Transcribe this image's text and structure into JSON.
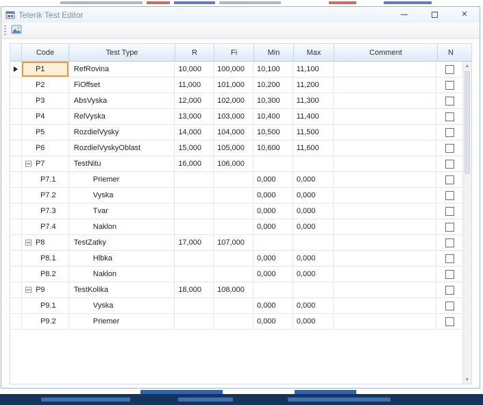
{
  "window": {
    "title": "Telerik Test Editor"
  },
  "toolbar": {
    "image_tool": "image-icon"
  },
  "grid": {
    "columns": [
      "Code",
      "Test Type",
      "R",
      "Fi",
      "Min",
      "Max",
      "Comment",
      "N"
    ],
    "rows": [
      {
        "code": "P1",
        "type": "RefRovina",
        "r": "10,000",
        "fi": "100,000",
        "min": "10,100",
        "max": "11,100",
        "comment": "",
        "level": 0,
        "group": false,
        "current": true,
        "checked": false
      },
      {
        "code": "P2",
        "type": "FiOffset",
        "r": "11,000",
        "fi": "101,000",
        "min": "10,200",
        "max": "11,200",
        "comment": "",
        "level": 0,
        "group": false,
        "checked": false
      },
      {
        "code": "P3",
        "type": "AbsVyska",
        "r": "12,000",
        "fi": "102,000",
        "min": "10,300",
        "max": "11,300",
        "comment": "",
        "level": 0,
        "group": false,
        "checked": false
      },
      {
        "code": "P4",
        "type": "RelVyska",
        "r": "13,000",
        "fi": "103,000",
        "min": "10,400",
        "max": "11,400",
        "comment": "",
        "level": 0,
        "group": false,
        "checked": false
      },
      {
        "code": "P5",
        "type": "RozdielVysky",
        "r": "14,000",
        "fi": "104,000",
        "min": "10,500",
        "max": "11,500",
        "comment": "",
        "level": 0,
        "group": false,
        "checked": false
      },
      {
        "code": "P6",
        "type": "RozdielVyskyOblast",
        "r": "15,000",
        "fi": "105,000",
        "min": "10,600",
        "max": "11,600",
        "comment": "",
        "level": 0,
        "group": false,
        "checked": false
      },
      {
        "code": "P7",
        "type": "TestNitu",
        "r": "16,000",
        "fi": "106,000",
        "min": "",
        "max": "",
        "comment": "",
        "level": 0,
        "group": true,
        "expanded": true,
        "checked": false
      },
      {
        "code": "P7.1",
        "type": "Priemer",
        "r": "",
        "fi": "",
        "min": "0,000",
        "max": "0,000",
        "comment": "",
        "level": 1,
        "group": false,
        "checked": false
      },
      {
        "code": "P7.2",
        "type": "Vyska",
        "r": "",
        "fi": "",
        "min": "0,000",
        "max": "0,000",
        "comment": "",
        "level": 1,
        "group": false,
        "checked": false
      },
      {
        "code": "P7.3",
        "type": "Tvar",
        "r": "",
        "fi": "",
        "min": "0,000",
        "max": "0,000",
        "comment": "",
        "level": 1,
        "group": false,
        "checked": false
      },
      {
        "code": "P7.4",
        "type": "Naklon",
        "r": "",
        "fi": "",
        "min": "0,000",
        "max": "0,000",
        "comment": "",
        "level": 1,
        "group": false,
        "checked": false
      },
      {
        "code": "P8",
        "type": "TestZatky",
        "r": "17,000",
        "fi": "107,000",
        "min": "",
        "max": "",
        "comment": "",
        "level": 0,
        "group": true,
        "expanded": true,
        "checked": false
      },
      {
        "code": "P8.1",
        "type": "Hlbka",
        "r": "",
        "fi": "",
        "min": "0,000",
        "max": "0,000",
        "comment": "",
        "level": 1,
        "group": false,
        "checked": false
      },
      {
        "code": "P8.2",
        "type": "Naklon",
        "r": "",
        "fi": "",
        "min": "0,000",
        "max": "0,000",
        "comment": "",
        "level": 1,
        "group": false,
        "checked": false
      },
      {
        "code": "P9",
        "type": "TestKolika",
        "r": "18,000",
        "fi": "108,000",
        "min": "",
        "max": "",
        "comment": "",
        "level": 0,
        "group": true,
        "expanded": true,
        "checked": false
      },
      {
        "code": "P9.1",
        "type": "Vyska",
        "r": "",
        "fi": "",
        "min": "0,000",
        "max": "0,000",
        "comment": "",
        "level": 1,
        "group": false,
        "checked": false
      },
      {
        "code": "P9.2",
        "type": "Priemer",
        "r": "",
        "fi": "",
        "min": "0,000",
        "max": "0,000",
        "comment": "",
        "level": 1,
        "group": false,
        "checked": false
      }
    ]
  },
  "colors": {
    "current_cell_border": "#e79b36",
    "current_cell_bg": "#fdf0d6",
    "header_gradient_top": "#f8fbfe",
    "header_gradient_bottom": "#dde9f7",
    "bottom_strip": "#16345c"
  }
}
